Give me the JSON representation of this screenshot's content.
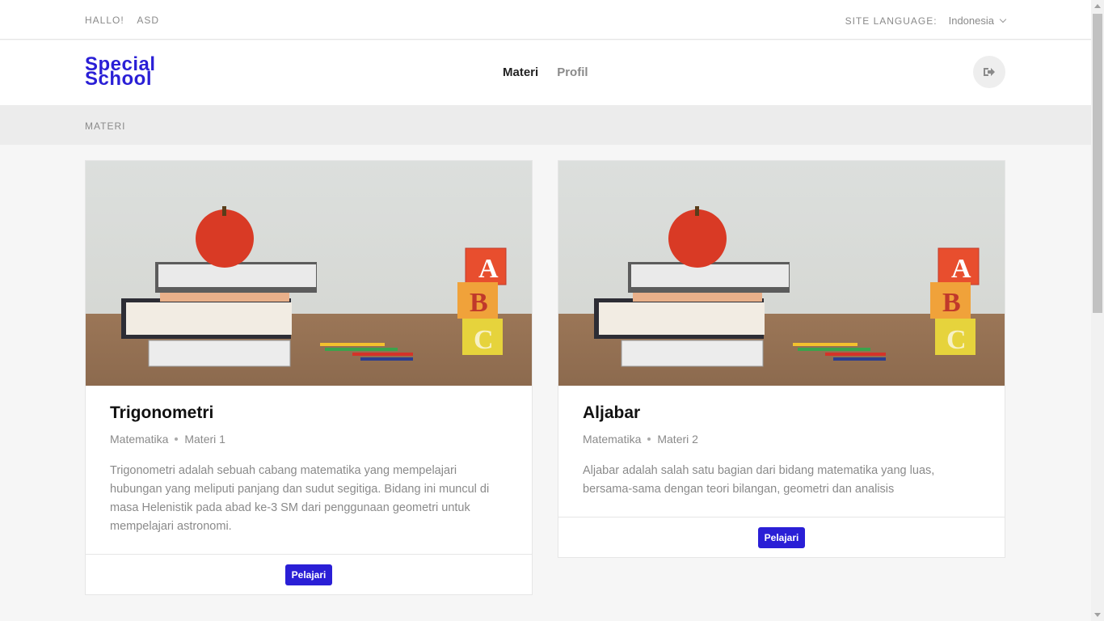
{
  "topbar": {
    "greeting": "HALLO!",
    "user": "ASD",
    "language_label": "SITE LANGUAGE:",
    "language_value": "Indonesia"
  },
  "header": {
    "logo_line1": "Special",
    "logo_line2": "School",
    "nav": [
      {
        "label": "Materi",
        "active": true
      },
      {
        "label": "Profil",
        "active": false
      }
    ]
  },
  "breadcrumb": "MATERI",
  "cards": [
    {
      "title": "Trigonometri",
      "subject": "Matematika",
      "number": "Materi 1",
      "description": "Trigonometri adalah sebuah cabang matematika yang mempelajari hubungan yang meliputi panjang dan sudut segitiga. Bidang ini muncul di masa Helenistik pada abad ke-3 SM dari penggunaan geometri untuk mempelajari astronomi.",
      "button": "Pelajari"
    },
    {
      "title": "Aljabar",
      "subject": "Matematika",
      "number": "Materi 2",
      "description": "Aljabar adalah salah satu bagian dari bidang matematika yang luas, bersama-sama dengan teori bilangan, geometri dan analisis",
      "button": "Pelajari"
    }
  ],
  "colors": {
    "accent": "#2a1fd6"
  }
}
